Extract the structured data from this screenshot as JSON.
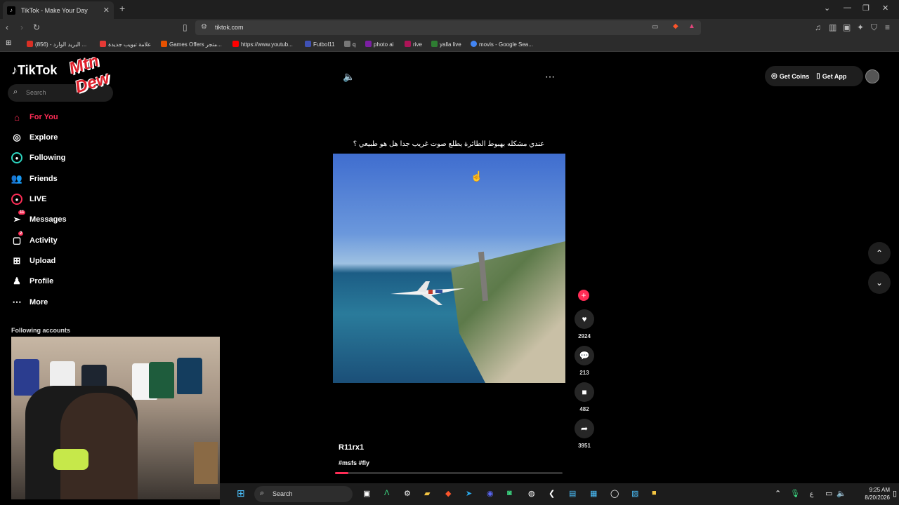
{
  "browser": {
    "tab_title": "TikTok - Make Your Day",
    "url": "tiktok.com",
    "bookmarks": [
      {
        "label": "(856) - البريد الوارد ...",
        "color": "#d93025"
      },
      {
        "label": "علامة تبويب جديدة",
        "color": "#e53935"
      },
      {
        "label": "Games Offers متجر...",
        "color": "#e65100"
      },
      {
        "label": "https://www.youtub...",
        "color": "#ff0000"
      },
      {
        "label": "Futbol11",
        "color": "#3f51b5"
      },
      {
        "label": "q",
        "color": "#777777"
      },
      {
        "label": "photo ai",
        "color": "#7b1fa2"
      },
      {
        "label": "rive",
        "color": "#ad1457"
      },
      {
        "label": "yalla live",
        "color": "#2e7d32"
      },
      {
        "label": "movis - Google Sea...",
        "color": "#4285f4"
      }
    ]
  },
  "tiktok": {
    "logo": "TikTok",
    "search_placeholder": "Search",
    "nav": [
      {
        "label": "For You",
        "icon": "home-icon",
        "active": true
      },
      {
        "label": "Explore",
        "icon": "compass-icon"
      },
      {
        "label": "Following",
        "icon": "following-icon"
      },
      {
        "label": "Friends",
        "icon": "friends-icon"
      },
      {
        "label": "LIVE",
        "icon": "live-icon"
      },
      {
        "label": "Messages",
        "icon": "messages-icon",
        "badge": "11"
      },
      {
        "label": "Activity",
        "icon": "activity-icon",
        "badge": "2"
      },
      {
        "label": "Upload",
        "icon": "upload-icon"
      },
      {
        "label": "Profile",
        "icon": "profile-icon"
      },
      {
        "label": "More",
        "icon": "more-icon"
      }
    ],
    "following_accounts_heading": "Following accounts",
    "get_coins": "Get Coins",
    "get_app": "Get App",
    "video": {
      "caption": "عندي مشكله بهبوط الطائرة يطلع صوت غريب جدا هل هو طبيعي ؟",
      "author": "R11rx1",
      "tags": "#msfs #fly",
      "progress": 0.06,
      "likes": "2924",
      "comments": "213",
      "saves": "482",
      "shares": "3951"
    },
    "overlay_logo_text": "Mtn Dew"
  },
  "taskbar": {
    "search_label": "Search",
    "time": "9:25 AM",
    "date": "8/20/2026",
    "lang": "ع"
  },
  "colors": {
    "accent": "#fe2c55"
  }
}
